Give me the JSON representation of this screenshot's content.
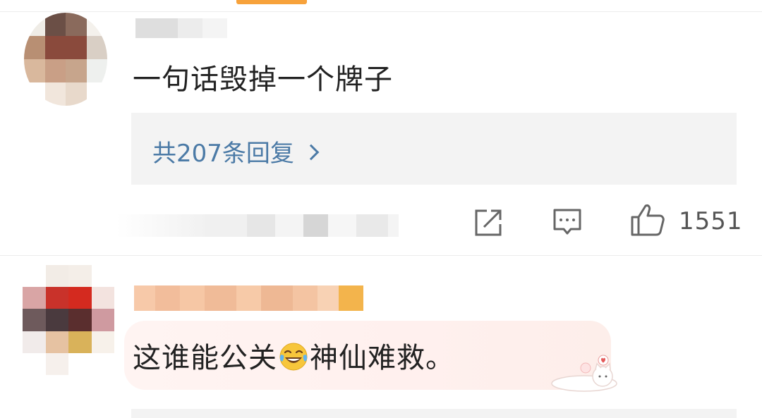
{
  "comments": [
    {
      "text": "一句话毁掉一个牌子",
      "reply_link": "共207条回复",
      "like_count": "1551"
    },
    {
      "text_before": "这谁能公关",
      "emoji": "laughing-tears-emoji",
      "text_after": "神仙难救。"
    }
  ],
  "icons": {
    "share": "share-icon",
    "comment": "comment-icon",
    "like": "thumbs-up-icon",
    "reply_arrow": "chevron-right-icon"
  },
  "colors": {
    "link": "#4b7aa6",
    "text": "#222222",
    "reply_bg": "#f3f3f3",
    "accent_orange": "#f7a23b"
  }
}
